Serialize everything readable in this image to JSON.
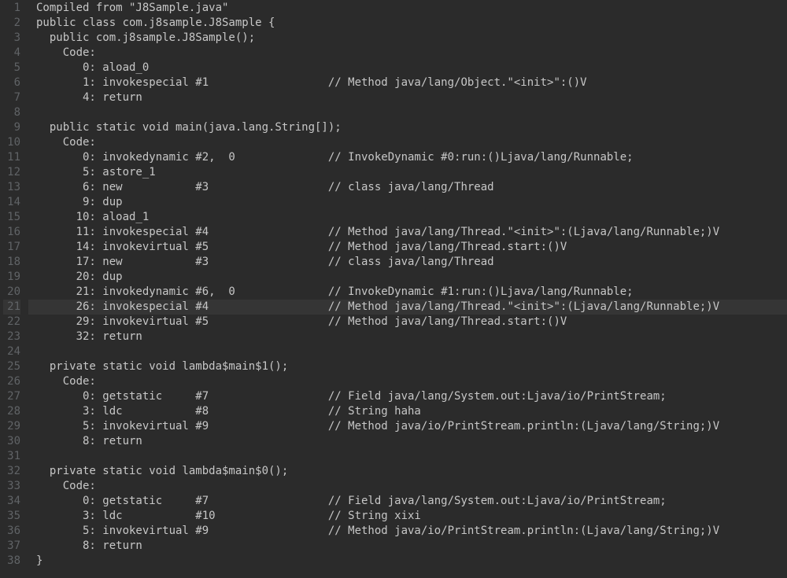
{
  "editor": {
    "highlighted_line": 21,
    "lines": [
      "Compiled from \"J8Sample.java\"",
      "public class com.j8sample.J8Sample {",
      "  public com.j8sample.J8Sample();",
      "    Code:",
      "       0: aload_0",
      "       1: invokespecial #1                  // Method java/lang/Object.\"<init>\":()V",
      "       4: return",
      "",
      "  public static void main(java.lang.String[]);",
      "    Code:",
      "       0: invokedynamic #2,  0              // InvokeDynamic #0:run:()Ljava/lang/Runnable;",
      "       5: astore_1",
      "       6: new           #3                  // class java/lang/Thread",
      "       9: dup",
      "      10: aload_1",
      "      11: invokespecial #4                  // Method java/lang/Thread.\"<init>\":(Ljava/lang/Runnable;)V",
      "      14: invokevirtual #5                  // Method java/lang/Thread.start:()V",
      "      17: new           #3                  // class java/lang/Thread",
      "      20: dup",
      "      21: invokedynamic #6,  0              // InvokeDynamic #1:run:()Ljava/lang/Runnable;",
      "      26: invokespecial #4                  // Method java/lang/Thread.\"<init>\":(Ljava/lang/Runnable;)V",
      "      29: invokevirtual #5                  // Method java/lang/Thread.start:()V",
      "      32: return",
      "",
      "  private static void lambda$main$1();",
      "    Code:",
      "       0: getstatic     #7                  // Field java/lang/System.out:Ljava/io/PrintStream;",
      "       3: ldc           #8                  // String haha",
      "       5: invokevirtual #9                  // Method java/io/PrintStream.println:(Ljava/lang/String;)V",
      "       8: return",
      "",
      "  private static void lambda$main$0();",
      "    Code:",
      "       0: getstatic     #7                  // Field java/lang/System.out:Ljava/io/PrintStream;",
      "       3: ldc           #10                 // String xixi",
      "       5: invokevirtual #9                  // Method java/io/PrintStream.println:(Ljava/lang/String;)V",
      "       8: return",
      "}"
    ]
  }
}
